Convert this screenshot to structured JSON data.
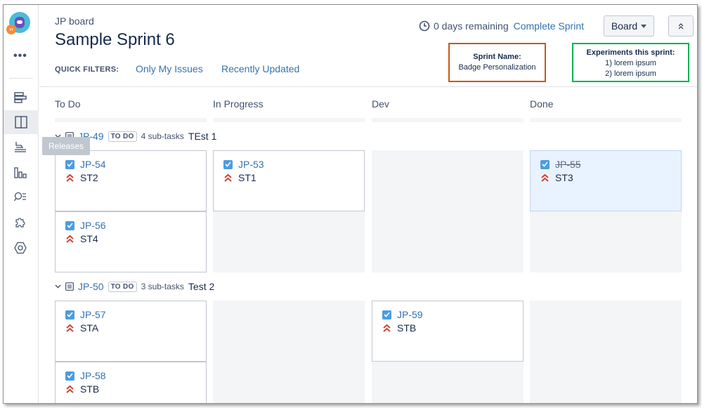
{
  "sidebar": {
    "more_label": "•••",
    "tooltip": "Releases",
    "icons": [
      "backlog-icon",
      "board-icon",
      "releases-icon",
      "reports-icon",
      "issues-search-icon",
      "add-ons-icon",
      "settings-icon"
    ]
  },
  "header": {
    "project": "JP board",
    "title": "Sample Sprint 6",
    "remaining": "0 days remaining",
    "complete_sprint": "Complete Sprint",
    "board_button": "Board"
  },
  "quick_filters": {
    "label": "QUICK FILTERS:",
    "items": [
      "Only My Issues",
      "Recently Updated"
    ]
  },
  "notes": {
    "sprint_title": "Sprint Name:",
    "sprint_value": "Badge Personalization",
    "exp_title": "Experiments this sprint:",
    "exp_line1": "1) lorem ipsum",
    "exp_line2": "2) lorem ipsum"
  },
  "columns": [
    "To Do",
    "In Progress",
    "Dev",
    "Done"
  ],
  "swimlanes": [
    {
      "key": "JP-49",
      "status": "TO DO",
      "subtasks": "4 sub-tasks",
      "summary": "TEst 1",
      "cards": [
        {
          "key": "JP-54",
          "summary": "ST2"
        },
        {
          "key": "JP-56",
          "summary": "ST4"
        },
        {
          "key": "JP-53",
          "summary": "ST1"
        },
        {
          "key": "JP-55",
          "summary": "ST3"
        }
      ]
    },
    {
      "key": "JP-50",
      "status": "TO DO",
      "subtasks": "3 sub-tasks",
      "summary": "Test 2",
      "cards": [
        {
          "key": "JP-57",
          "summary": "STA"
        },
        {
          "key": "JP-58",
          "summary": "STB"
        },
        {
          "key": "JP-59",
          "summary": "STB"
        }
      ]
    }
  ],
  "colors": {
    "link": "#3572b0",
    "priority_high": "#d04437",
    "checkbox": "#4a9de0",
    "sprint_note_border": "#c55a11",
    "experiments_note_border": "#00b050"
  }
}
